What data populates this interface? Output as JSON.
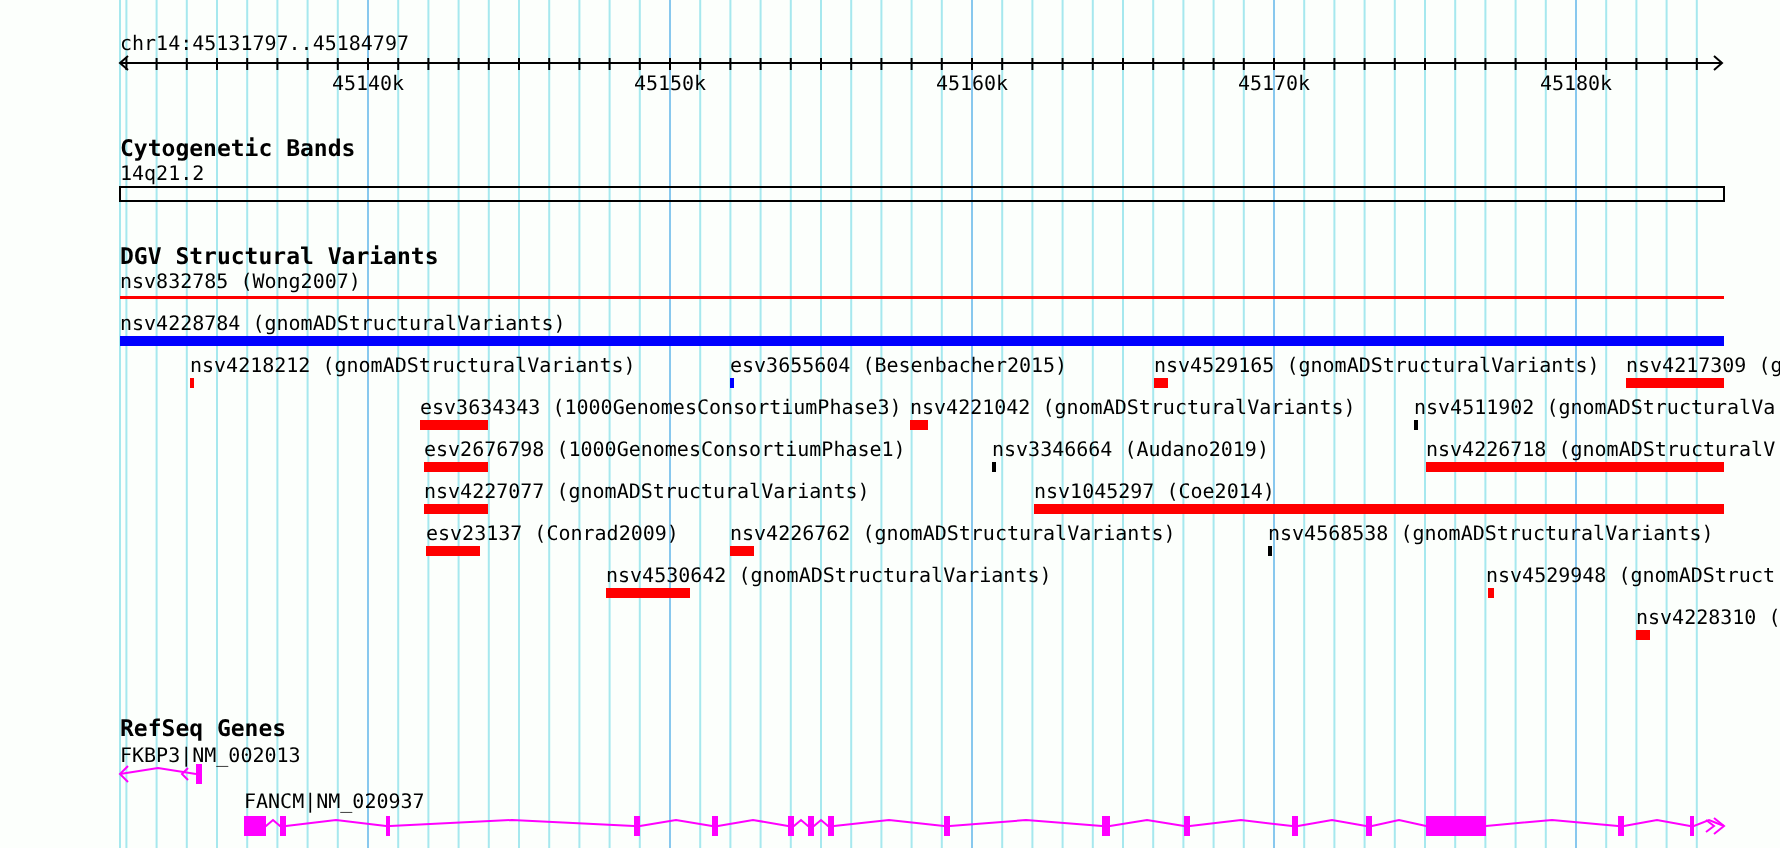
{
  "ruler": {
    "location": "chr14:45131797..45184797",
    "ticks": [
      "45140k",
      "45150k",
      "45160k",
      "45170k",
      "45180k"
    ]
  },
  "tracks": [
    {
      "title": "Cytogenetic Bands",
      "kind": "bands",
      "features": [
        {
          "label": "14q21.2"
        }
      ]
    },
    {
      "title": "DGV Structural Variants",
      "kind": "variants",
      "features": [
        {
          "label": "nsv832785 (Wong2007)",
          "color": "#ff0000"
        },
        {
          "label": "nsv4228784 (gnomADStructuralVariants)",
          "color": "#0000ff"
        },
        {
          "label": "nsv4218212 (gnomADStructuralVariants)",
          "color": "#ff0000"
        },
        {
          "label": "esv3655604 (Besenbacher2015)",
          "color": "#0000ff"
        },
        {
          "label": "nsv4529165 (gnomADStructuralVariants)",
          "color": "#ff0000"
        },
        {
          "label": "nsv4217309 (g",
          "color": "#ff0000"
        },
        {
          "label": "esv3634343 (1000GenomesConsortiumPhase3)",
          "color": "#ff0000"
        },
        {
          "label": "nsv4221042 (gnomADStructuralVariants)",
          "color": "#ff0000"
        },
        {
          "label": "nsv4511902 (gnomADStructuralVa",
          "color": "#000000"
        },
        {
          "label": "esv2676798 (1000GenomesConsortiumPhase1)",
          "color": "#ff0000"
        },
        {
          "label": "nsv3346664 (Audano2019)",
          "color": "#000000"
        },
        {
          "label": "nsv4226718 (gnomADStructuralV",
          "color": "#ff0000"
        },
        {
          "label": "nsv4227077 (gnomADStructuralVariants)",
          "color": "#ff0000"
        },
        {
          "label": "nsv1045297 (Coe2014)",
          "color": "#ff0000"
        },
        {
          "label": "esv23137 (Conrad2009)",
          "color": "#ff0000"
        },
        {
          "label": "nsv4226762 (gnomADStructuralVariants)",
          "color": "#ff0000"
        },
        {
          "label": "nsv4568538 (gnomADStructuralVariants)",
          "color": "#000000"
        },
        {
          "label": "nsv4530642 (gnomADStructuralVariants)",
          "color": "#ff0000"
        },
        {
          "label": "nsv4529948 (gnomADStruct",
          "color": "#ff0000"
        },
        {
          "label": "nsv4228310 (",
          "color": "#ff0000"
        }
      ]
    },
    {
      "title": "RefSeq Genes",
      "kind": "genes",
      "features": [
        {
          "label": "FKBP3|NM_002013"
        },
        {
          "label": "FANCM|NM_020937"
        }
      ]
    }
  ]
}
